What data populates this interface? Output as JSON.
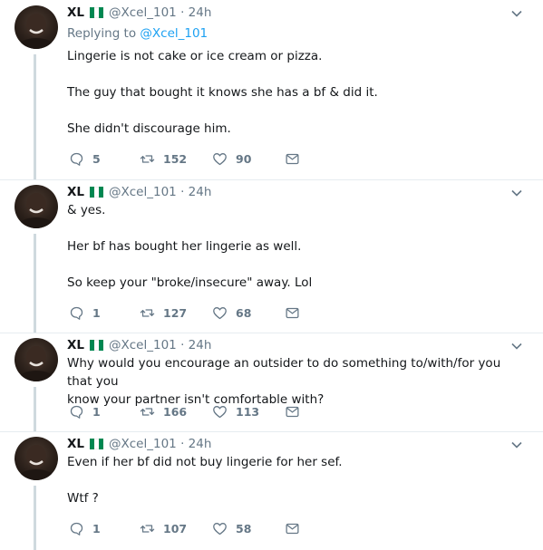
{
  "colors": {
    "link": "#1da1f2",
    "muted": "#657786",
    "text": "#14171a",
    "thread_line": "#cfd9de",
    "flag_green": "#008751"
  },
  "tweets": [
    {
      "name": "XL",
      "handle": "@Xcel_101",
      "time": "· 24h",
      "replying_label": "Replying to",
      "replying_handle": "@Xcel_101",
      "lines": [
        "Lingerie is not cake or ice cream or pizza.",
        "",
        "The guy that bought it knows she has a bf & did it.",
        "",
        "She didn't discourage him."
      ],
      "replies": "5",
      "retweets": "152",
      "likes": "90"
    },
    {
      "name": "XL",
      "handle": "@Xcel_101",
      "time": "· 24h",
      "lines": [
        "& yes.",
        "",
        "Her bf has bought her lingerie as well.",
        "",
        "So keep your \"broke/insecure\" away. Lol"
      ],
      "replies": "1",
      "retweets": "127",
      "likes": "68"
    },
    {
      "name": "XL",
      "handle": "@Xcel_101",
      "time": "· 24h",
      "lines": [
        "Why would you encourage an outsider to do something to/with/for you that you",
        "know your partner isn't comfortable with?"
      ],
      "replies": "1",
      "retweets": "166",
      "likes": "113"
    },
    {
      "name": "XL",
      "handle": "@Xcel_101",
      "time": "· 24h",
      "lines": [
        "Even if her bf did not buy lingerie for her sef.",
        "",
        "Wtf ?"
      ],
      "replies": "1",
      "retweets": "107",
      "likes": "58"
    }
  ]
}
